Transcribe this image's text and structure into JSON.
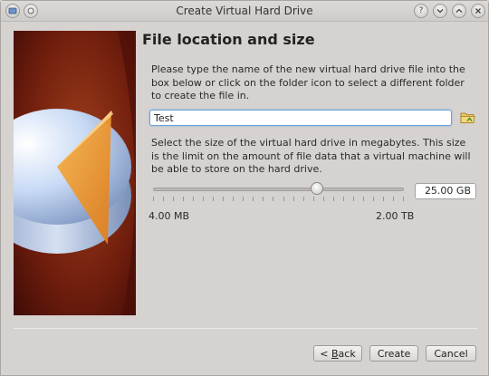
{
  "window": {
    "title": "Create Virtual Hard Drive",
    "controls": {
      "help": "?",
      "minimize": "⌄",
      "maximize": "⌃",
      "close": "✕"
    }
  },
  "page": {
    "heading": "File location and size",
    "location_description": "Please type the name of the new virtual hard drive file into the box below or click on the folder icon to select a different folder to create the file in.",
    "file_name": "Test",
    "size_description": "Select the size of the virtual hard drive in megabytes. This size is the limit on the amount of file data that a virtual machine will be able to store on the hard drive.",
    "size_value": "25.00 GB",
    "slider_fraction": 0.655,
    "min_label": "4.00 MB",
    "max_label": "2.00 TB"
  },
  "buttons": {
    "back_prefix": "< ",
    "back_mnemonic": "B",
    "back_rest": "ack",
    "create": "Create",
    "cancel": "Cancel"
  },
  "colors": {
    "accent": "#6b9fd6",
    "folder": "#e8c45a"
  }
}
